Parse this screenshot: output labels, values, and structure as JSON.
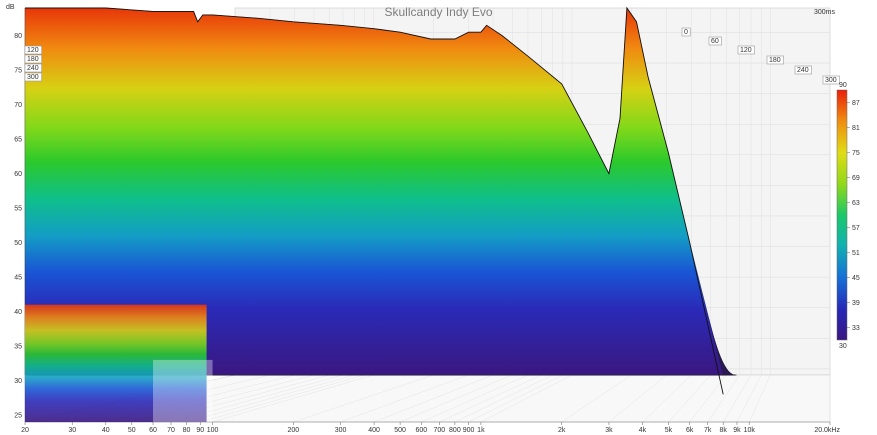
{
  "chart_data": {
    "type": "area",
    "title": "Skullcandy Indy Evo",
    "y_unit": "dB",
    "x_unit_label": "20.0kHz",
    "time_unit_label": "300ms",
    "x_scale": "log",
    "x_range": [
      20,
      20000
    ],
    "y_range": [
      24,
      84
    ],
    "x_ticks": [
      "20",
      "30",
      "40",
      "50",
      "60",
      "70",
      "80",
      "90",
      "100",
      "200",
      "300",
      "400",
      "500",
      "600",
      "700",
      "800",
      "900",
      "1k",
      "2k",
      "3k",
      "4k",
      "5k",
      "6k",
      "7k",
      "8k",
      "9k",
      "10k",
      "20.0kHz"
    ],
    "x_tick_values": [
      20,
      30,
      40,
      50,
      60,
      70,
      80,
      90,
      100,
      200,
      300,
      400,
      500,
      600,
      700,
      800,
      900,
      1000,
      2000,
      3000,
      4000,
      5000,
      6000,
      7000,
      8000,
      9000,
      10000,
      20000
    ],
    "y_ticks": [
      25,
      30,
      35,
      40,
      45,
      50,
      55,
      60,
      65,
      70,
      75,
      80
    ],
    "time_ticks_ms": [
      "0",
      "60",
      "120",
      "180",
      "240",
      "300"
    ],
    "time_ticks_left": [
      "120",
      "180",
      "240",
      "300"
    ],
    "colorbar": {
      "range": [
        30,
        90
      ],
      "ticks": [
        "33",
        "39",
        "45",
        "51",
        "57",
        "63",
        "69",
        "75",
        "81",
        "87"
      ],
      "top_label": "90",
      "bottom_label": "30"
    },
    "series": [
      {
        "frequency_hz": [
          20,
          40,
          60,
          85,
          88,
          92,
          100,
          150,
          200,
          300,
          400,
          500,
          650,
          800,
          900,
          1000,
          1050,
          1200,
          1500,
          2000,
          2500,
          3000,
          3300,
          3500,
          3800,
          4200,
          5000,
          6000,
          8000
        ],
        "level_db": [
          84,
          84,
          83.5,
          83.5,
          82,
          83,
          83,
          82.5,
          82,
          81.5,
          81,
          80.5,
          79.5,
          79.5,
          80.5,
          80.5,
          81.5,
          80,
          77,
          73,
          66,
          60,
          68,
          84,
          82,
          74,
          63,
          50,
          28
        ]
      }
    ]
  }
}
